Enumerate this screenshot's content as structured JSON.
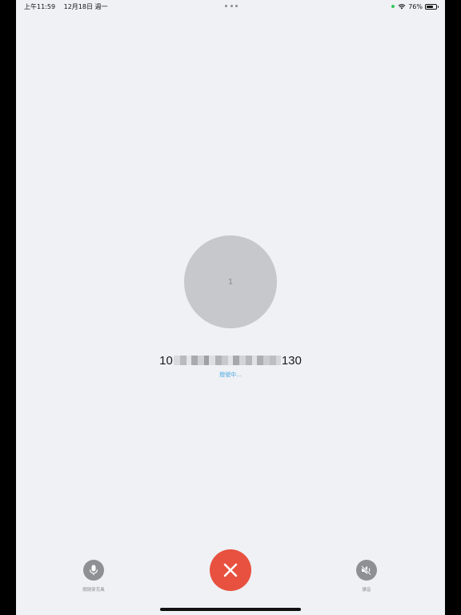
{
  "status_bar": {
    "time": "上午11:59",
    "date": "12月18日 週一",
    "battery_percent": "76%",
    "battery_level": 0.76
  },
  "call": {
    "avatar_text": "1",
    "number_prefix": "10",
    "number_suffix": "130",
    "status": "撥號中..."
  },
  "controls": {
    "mute_label": "關閉麥克風",
    "speaker_label": "擴音"
  },
  "colors": {
    "background": "#eff1f5",
    "hangup": "#e8513f",
    "status_text": "#4aa8e0",
    "avatar": "#c6c8cb"
  },
  "icons": {
    "mute": "microphone-icon",
    "hangup": "close-icon",
    "speaker": "speaker-muted-icon"
  }
}
